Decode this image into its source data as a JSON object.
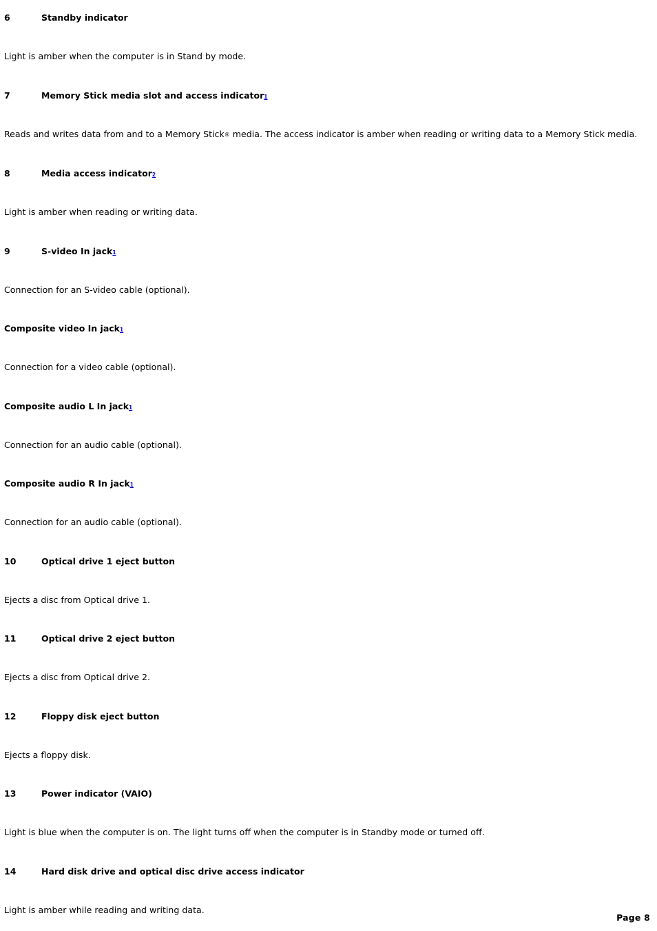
{
  "document": {
    "type": "manual-page",
    "footer_label": "Page 8",
    "footnote_link_color": "#0000cc",
    "text_color": "#000000",
    "background_color": "#ffffff"
  },
  "entries": [
    {
      "number": "6",
      "title": "Standby indicator",
      "footnote": "",
      "body": "Light is amber when the computer is in Stand by mode."
    },
    {
      "number": "7",
      "title": "Memory Stick media slot and access indicator",
      "footnote": "1",
      "body_pre": "Reads and writes data from and to a Memory Stick",
      "body_symbol": "®",
      "body_post": " media. The access indicator is amber when reading or writing data to a Memory Stick media."
    },
    {
      "number": "8",
      "title": "Media access indicator",
      "footnote": "2",
      "body": "Light is amber when reading or writing data."
    },
    {
      "number": "9",
      "title": "S-video In jack",
      "footnote": "1",
      "body": "Connection for an S-video cable (optional)."
    },
    {
      "number": "",
      "title": "Composite video In jack",
      "footnote": "1",
      "body": "Connection for a video cable (optional)."
    },
    {
      "number": "",
      "title": "Composite audio L In jack",
      "footnote": "1",
      "body": "Connection for an audio cable (optional)."
    },
    {
      "number": "",
      "title": "Composite audio R In jack",
      "footnote": "1",
      "body": "Connection for an audio cable (optional)."
    },
    {
      "number": "10",
      "title": "Optical drive 1 eject button",
      "footnote": "",
      "body": "Ejects a disc from Optical drive 1."
    },
    {
      "number": "11",
      "title": "Optical drive 2 eject button",
      "footnote": "",
      "body": "Ejects a disc from Optical drive 2."
    },
    {
      "number": "12",
      "title": "Floppy disk eject button",
      "footnote": "",
      "body": "Ejects a floppy disk."
    },
    {
      "number": "13",
      "title": "Power indicator (VAIO)",
      "footnote": "",
      "body": "Light is blue when the computer is on. The light turns off when the computer is in Standby mode or turned off."
    },
    {
      "number": "14",
      "title": "Hard disk drive and optical disc drive access indicator",
      "footnote": "",
      "body": "Light is amber while reading and writing data."
    }
  ]
}
